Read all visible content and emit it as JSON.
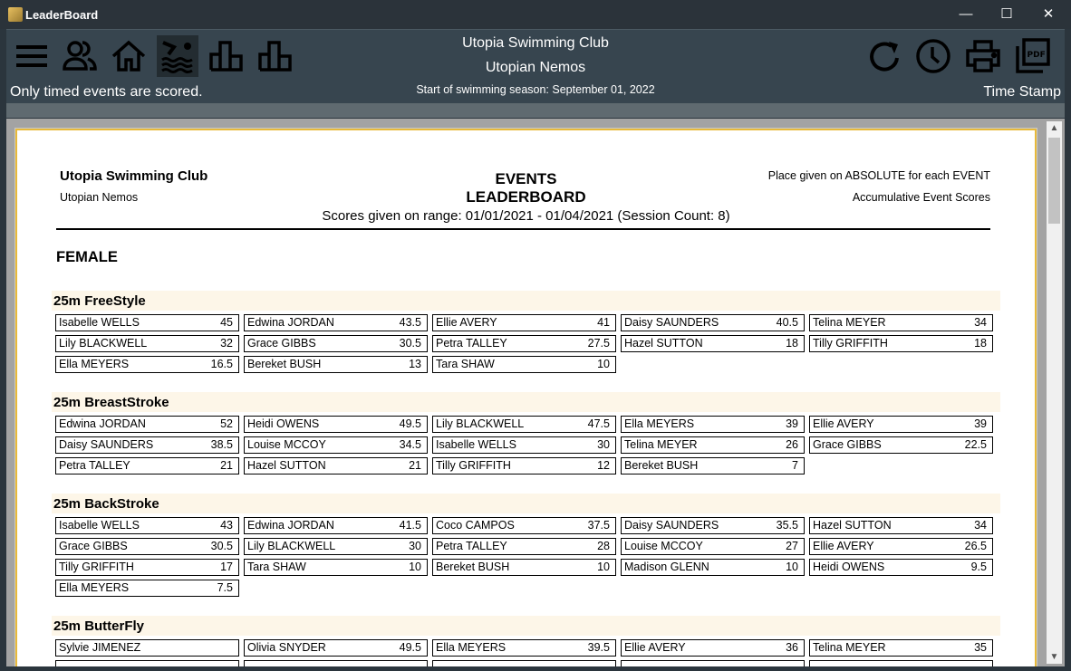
{
  "window": {
    "title": "LeaderBoard",
    "minimize": "—",
    "maximize": "☐",
    "close": "✕"
  },
  "toolbar": {
    "club": "Utopia Swimming Club",
    "team": "Utopian Nemos",
    "season": "Start of swimming season: September 01, 2022",
    "note": "Only timed events are scored.",
    "timestamp": "Time Stamp",
    "icons_left": [
      "menu-icon",
      "people-icon",
      "home-icon",
      "swimming-icon",
      "bar-chart-icon",
      "bar-chart-icon"
    ],
    "icons_right": [
      "refresh-icon",
      "clock-icon",
      "print-icon",
      "pdf-icon"
    ]
  },
  "report": {
    "club": "Utopia Swimming Club",
    "team": "Utopian Nemos",
    "title1": "EVENTS",
    "title2": "LEADERBOARD",
    "range": "Scores given on range: 01/01/2021 - 01/04/2021 (Session Count: 8)",
    "place_note": "Place given on ABSOLUTE for each EVENT",
    "score_note": "Accumulative Event Scores",
    "gender": "FEMALE",
    "events": [
      {
        "name": "25m FreeStyle",
        "entries": [
          [
            "Isabelle WELLS",
            "45"
          ],
          [
            "Edwina JORDAN",
            "43.5"
          ],
          [
            "Ellie AVERY",
            "41"
          ],
          [
            "Daisy SAUNDERS",
            "40.5"
          ],
          [
            "Telina MEYER",
            "34"
          ],
          [
            "Lily BLACKWELL",
            "32"
          ],
          [
            "Grace GIBBS",
            "30.5"
          ],
          [
            "Petra TALLEY",
            "27.5"
          ],
          [
            "Hazel SUTTON",
            "18"
          ],
          [
            "Tilly GRIFFITH",
            "18"
          ],
          [
            "Ella MEYERS",
            "16.5"
          ],
          [
            "Bereket BUSH",
            "13"
          ],
          [
            "Tara SHAW",
            "10"
          ]
        ]
      },
      {
        "name": "25m BreastStroke",
        "entries": [
          [
            "Edwina JORDAN",
            "52"
          ],
          [
            "Heidi OWENS",
            "49.5"
          ],
          [
            "Lily BLACKWELL",
            "47.5"
          ],
          [
            "Ella MEYERS",
            "39"
          ],
          [
            "Ellie AVERY",
            "39"
          ],
          [
            "Daisy SAUNDERS",
            "38.5"
          ],
          [
            "Louise MCCOY",
            "34.5"
          ],
          [
            "Isabelle WELLS",
            "30"
          ],
          [
            "Telina MEYER",
            "26"
          ],
          [
            "Grace GIBBS",
            "22.5"
          ],
          [
            "Petra TALLEY",
            "21"
          ],
          [
            "Hazel SUTTON",
            "21"
          ],
          [
            "Tilly GRIFFITH",
            "12"
          ],
          [
            "Bereket BUSH",
            "7"
          ]
        ]
      },
      {
        "name": "25m BackStroke",
        "entries": [
          [
            "Isabelle WELLS",
            "43"
          ],
          [
            "Edwina JORDAN",
            "41.5"
          ],
          [
            "Coco CAMPOS",
            "37.5"
          ],
          [
            "Daisy SAUNDERS",
            "35.5"
          ],
          [
            "Hazel SUTTON",
            "34"
          ],
          [
            "Grace GIBBS",
            "30.5"
          ],
          [
            "Lily BLACKWELL",
            "30"
          ],
          [
            "Petra TALLEY",
            "28"
          ],
          [
            "Louise MCCOY",
            "27"
          ],
          [
            "Ellie AVERY",
            "26.5"
          ],
          [
            "Tilly GRIFFITH",
            "17"
          ],
          [
            "Tara SHAW",
            "10"
          ],
          [
            "Bereket BUSH",
            "10"
          ],
          [
            "Madison GLENN",
            "10"
          ],
          [
            "Heidi OWENS",
            "9.5"
          ],
          [
            "Ella MEYERS",
            "7.5"
          ]
        ]
      },
      {
        "name": "25m ButterFly",
        "entries": [
          [
            "Sylvie JIMENEZ",
            ""
          ],
          [
            "Olivia SNYDER",
            "49.5"
          ],
          [
            "Ella MEYERS",
            "39.5"
          ],
          [
            "Ellie AVERY",
            "36"
          ],
          [
            "Telina MEYER",
            "35"
          ],
          [
            "",
            ""
          ],
          [
            "",
            ""
          ],
          [
            "",
            ""
          ],
          [
            "",
            ""
          ],
          [
            "",
            ""
          ]
        ]
      }
    ]
  }
}
